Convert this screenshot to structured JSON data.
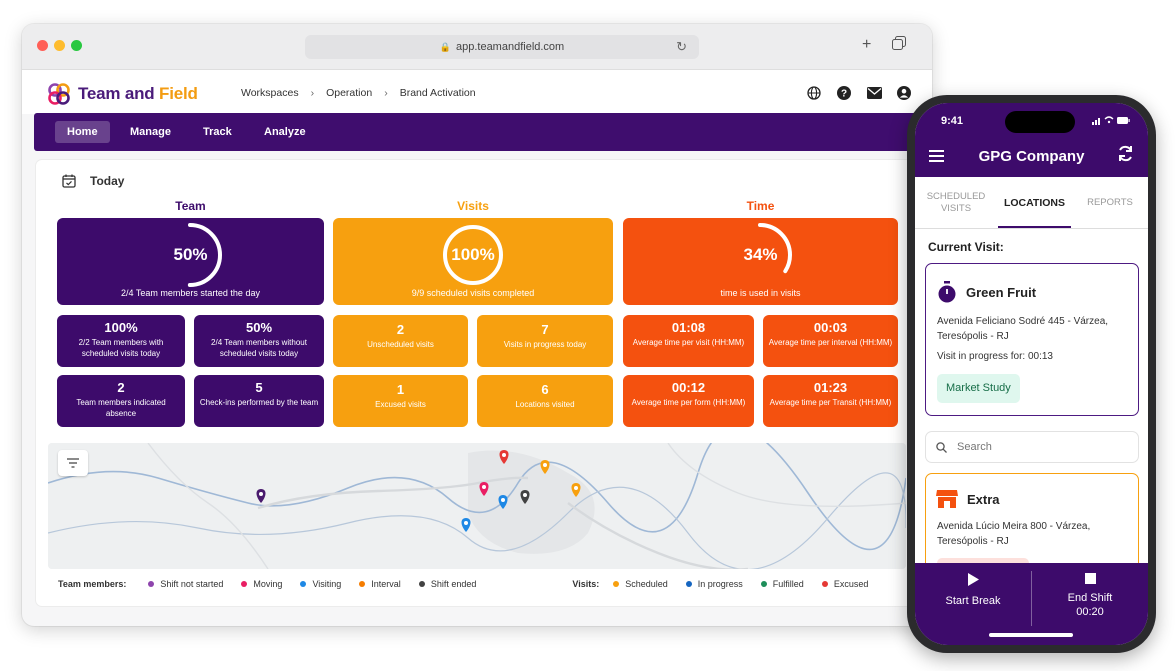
{
  "browser": {
    "url": "app.teamandfield.com"
  },
  "app": {
    "logo_part1": "Team and ",
    "logo_part2": "Field",
    "breadcrumbs": [
      "Workspaces",
      "Operation",
      "Brand Activation"
    ],
    "nav": [
      "Home",
      "Manage",
      "Track",
      "Analyze"
    ]
  },
  "today": {
    "title": "Today",
    "team": {
      "heading": "Team",
      "big_value": "50%",
      "big_fraction": 0.5,
      "big_caption": "2/4 Team members started the day",
      "cards": [
        {
          "value": "100%",
          "label": "2/2 Team members with scheduled visits today"
        },
        {
          "value": "50%",
          "label": "2/4 Team members without scheduled visits today"
        },
        {
          "value": "2",
          "label": "Team members indicated absence"
        },
        {
          "value": "5",
          "label": "Check-ins performed by the team"
        }
      ]
    },
    "visits": {
      "heading": "Visits",
      "big_value": "100%",
      "big_fraction": 1.0,
      "big_caption": "9/9 scheduled visits completed",
      "cards": [
        {
          "value": "2",
          "label": "Unscheduled visits"
        },
        {
          "value": "7",
          "label": "Visits in progress today"
        },
        {
          "value": "1",
          "label": "Excused visits"
        },
        {
          "value": "6",
          "label": "Locations visited"
        }
      ]
    },
    "time": {
      "heading": "Time",
      "big_value": "34%",
      "big_fraction": 0.34,
      "big_caption": "time is used in visits",
      "cards": [
        {
          "value": "01:08",
          "label": "Average time per visit (HH:MM)"
        },
        {
          "value": "00:03",
          "label": "Average time per interval (HH:MM)"
        },
        {
          "value": "00:12",
          "label": "Average time per form (HH:MM)"
        },
        {
          "value": "01:23",
          "label": "Average time per Transit (HH:MM)"
        }
      ]
    }
  },
  "legend": {
    "team_title": "Team members:",
    "team_items": [
      {
        "label": "Shift not started",
        "color": "#8e44ad"
      },
      {
        "label": "Moving",
        "color": "#e91e63"
      },
      {
        "label": "Visiting",
        "color": "#1e88e5"
      },
      {
        "label": "Interval",
        "color": "#f57c00"
      },
      {
        "label": "Shift ended",
        "color": "#424242"
      }
    ],
    "visits_title": "Visits:",
    "visit_items": [
      {
        "label": "Scheduled",
        "color": "#f7a00f"
      },
      {
        "label": "In progress",
        "color": "#1565c0"
      },
      {
        "label": "Fulfilled",
        "color": "#1e8e5a"
      },
      {
        "label": "Excused",
        "color": "#e53935"
      }
    ]
  },
  "phone": {
    "time": "9:41",
    "title": "GPG Company",
    "tabs": [
      "SCHEDULED VISITS",
      "LOCATIONS",
      "REPORTS"
    ],
    "current_visit_label": "Current Visit:",
    "current": {
      "name": "Green Fruit",
      "address": "Avenida Feliciano Sodré 445 - Várzea, Teresópolis - RJ",
      "progress": "Visit in progress for: 00:13",
      "tag": "Market Study"
    },
    "search_placeholder": "Search",
    "next": {
      "name": "Extra",
      "address": "Avenida Lúcio Meira 800 - Várzea, Teresópolis - RJ"
    },
    "start_break": "Start Break",
    "end_shift": "End Shift",
    "end_shift_time": "00:20"
  }
}
